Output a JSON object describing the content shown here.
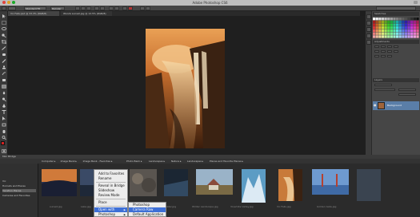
{
  "window": {
    "title": "Adobe Photoshop CS6"
  },
  "options_bar": {
    "preset_value": "Standard Fit",
    "mode_value": "Regular"
  },
  "tabs": [
    {
      "label": "Vic Falls.psd @ 33.3% (RGB/8)"
    },
    {
      "label": "Woods sunset.jpg @ 12.5% (RGB/8)"
    }
  ],
  "right_panel": {
    "swatches_header": "Swatches",
    "adjustments_header": "Adjustments",
    "layers_header": "Layers",
    "layer_name": "Background"
  },
  "mini_bridge": {
    "title": "Mini Bridge",
    "path": [
      "Computer",
      "Image Bank",
      "Image Bank - Favorites",
      "Photo Bank",
      "Landscapes",
      "Nature",
      "Landscapes",
      "Places and Favorite Places"
    ],
    "favorites": [
      "Vic",
      "Hornets and Places",
      "Vacation Places",
      "Cameras and Favorites"
    ],
    "selected_favorite_index": 2,
    "thumbnails": [
      {
        "caption": "sunset.jpg"
      },
      {
        "caption": "Lake.jpg"
      },
      {
        "caption": "Vic Falls.jpg"
      },
      {
        "caption": "Water.jpg"
      },
      {
        "caption": "Winter Landscape.jpg"
      },
      {
        "caption": "Yosemite Valley.jpg"
      },
      {
        "caption": "Ice Peak.jpg"
      },
      {
        "caption": "Vic Falls.jpg"
      },
      {
        "caption": "Golden Gate.jpg"
      }
    ]
  },
  "context_menu": {
    "items": [
      "Add to Favorites",
      "Rename",
      "Reveal in Bridge",
      "Slideshow",
      "Review Mode",
      "Place",
      "Open with",
      "Photoshop"
    ],
    "submenu": [
      "Photoshop",
      "Camera Raw",
      "Default Application"
    ],
    "highlighted_item": "Open with",
    "highlighted_sub": "Camera Raw"
  },
  "colors": {
    "accent": "#3d6fd6",
    "foreground": "#d32222",
    "background": "#ffffff"
  }
}
